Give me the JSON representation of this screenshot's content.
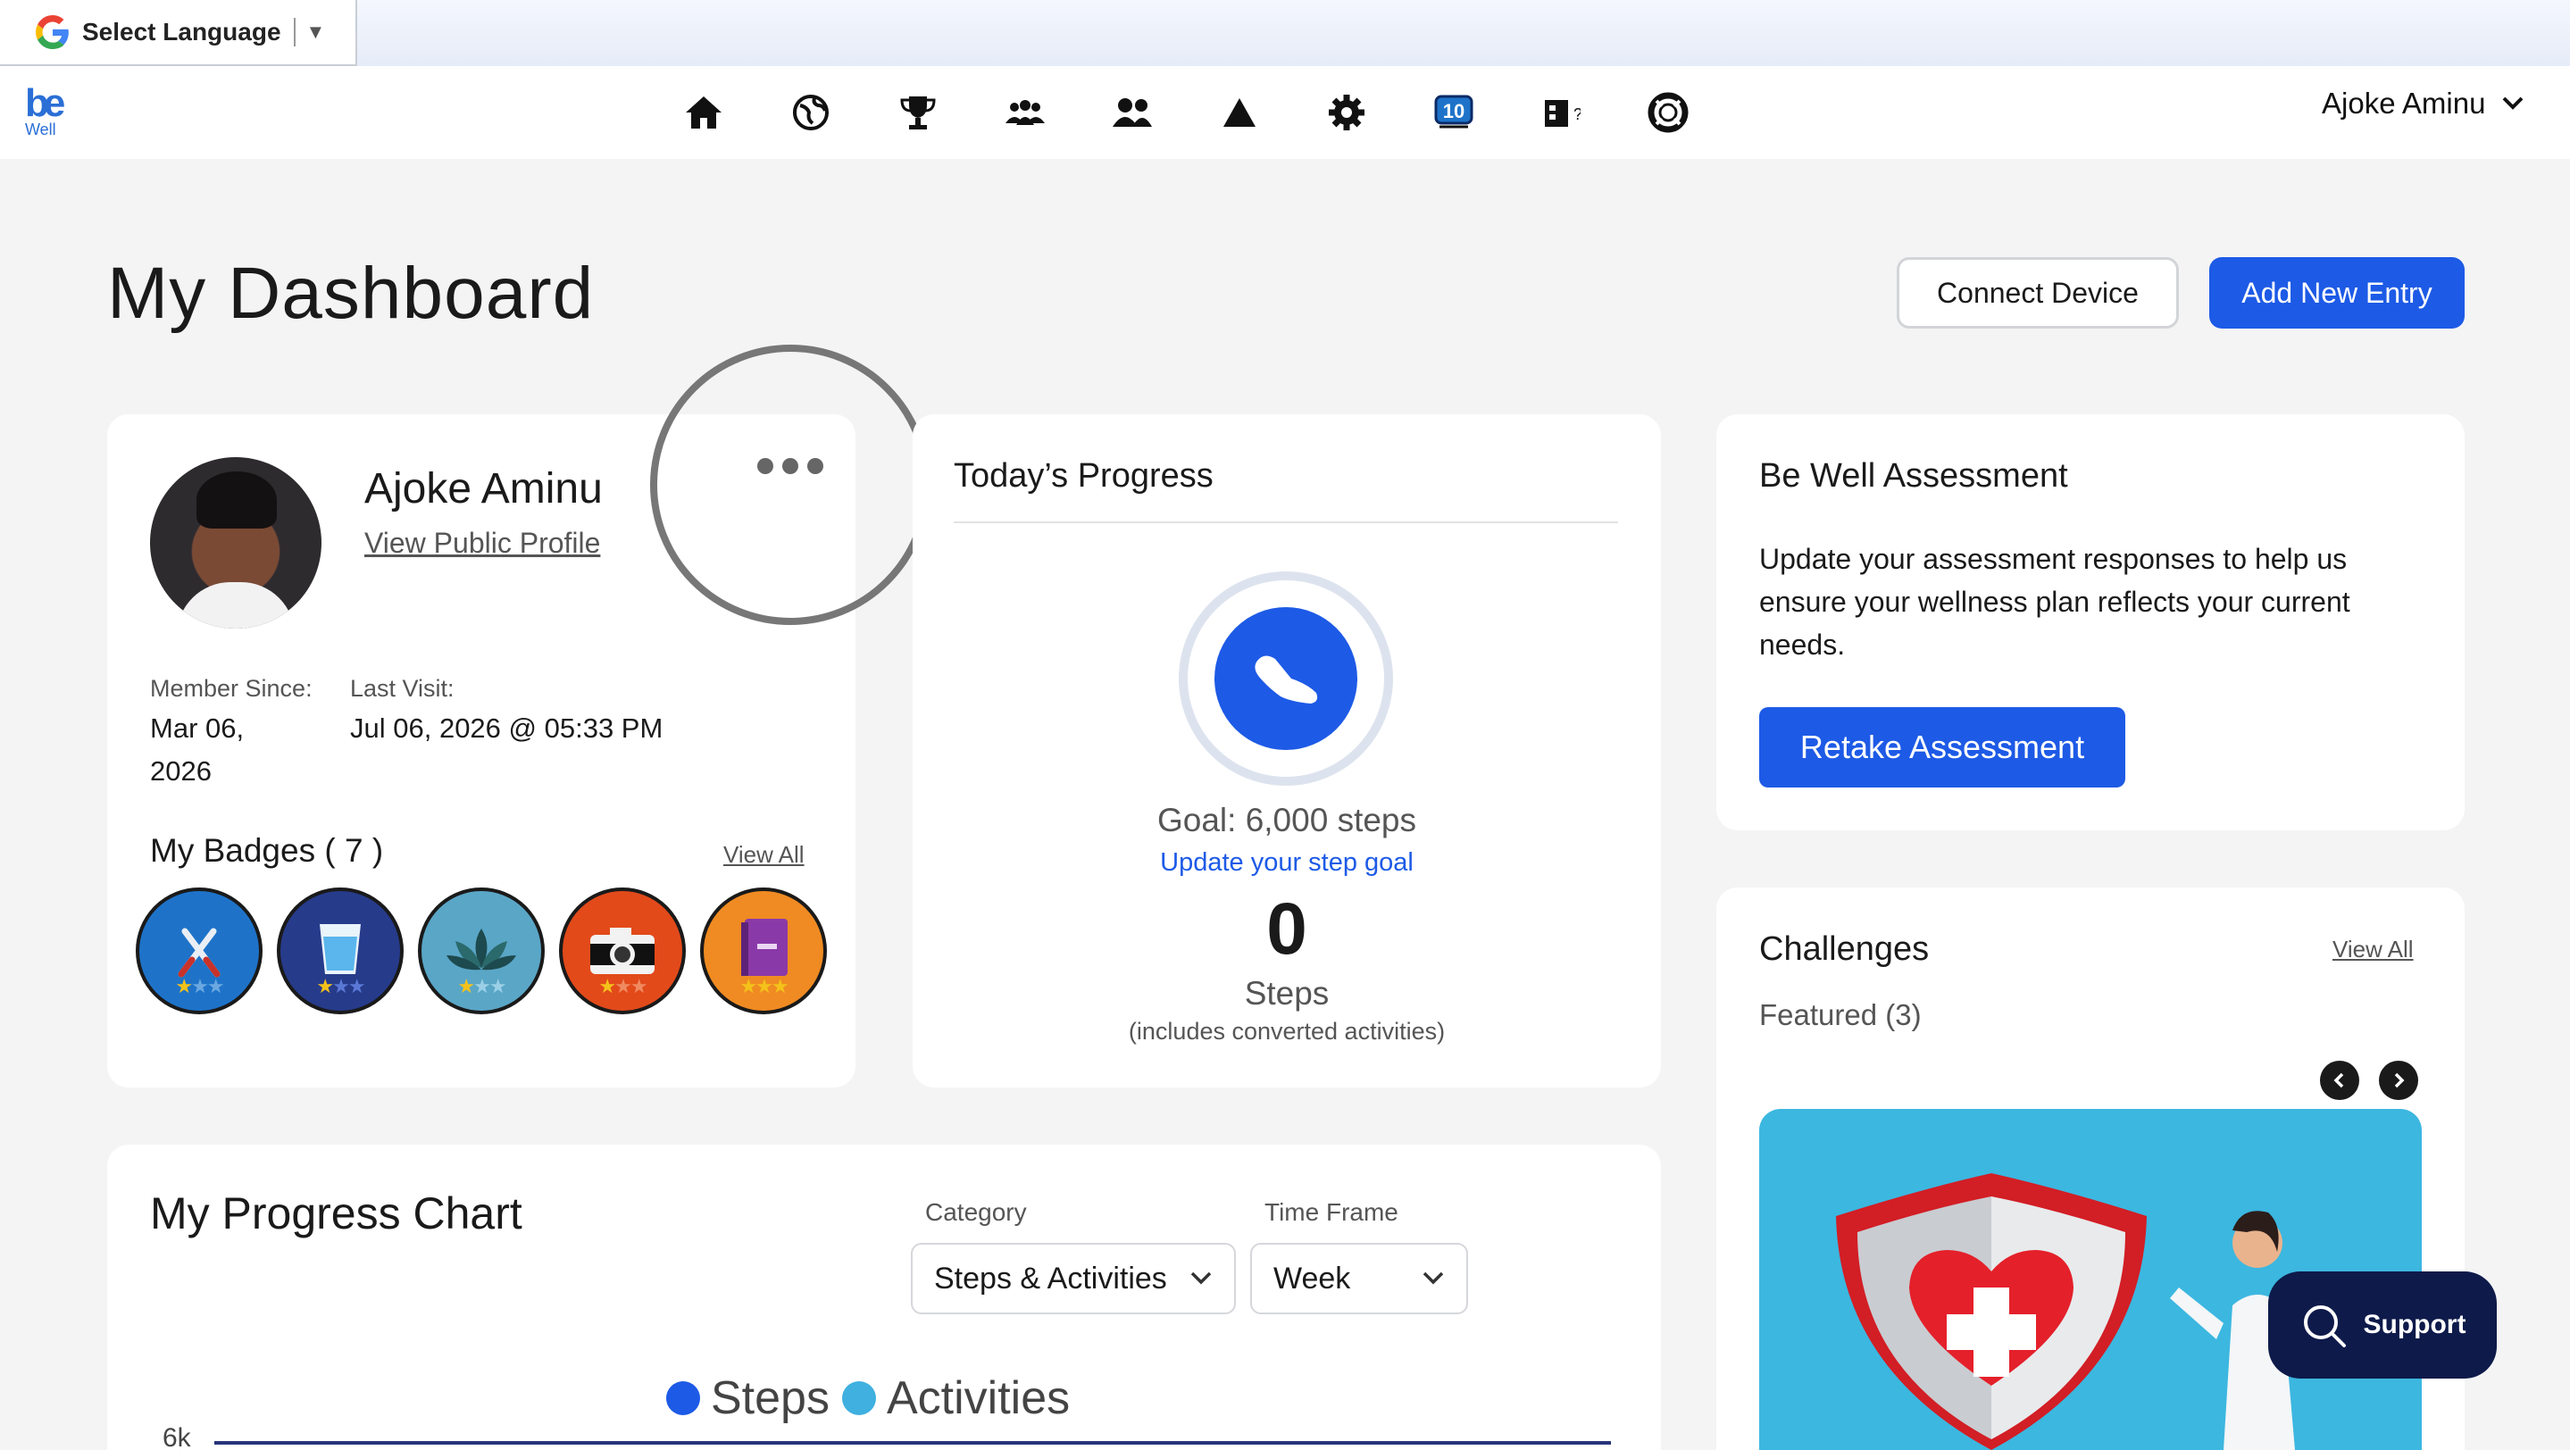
{
  "translate": {
    "label": "Select Language",
    "caret": "▼"
  },
  "brand": {
    "logo_text": "be",
    "logo_sub": "Well"
  },
  "nav": {
    "icons": [
      "home-icon",
      "globe-icon",
      "trophy-icon",
      "groups-icon",
      "people-icon",
      "triangle-icon",
      "gear-icon",
      "ten-badge-icon",
      "coffee-cup-icon",
      "lifebuoy-icon"
    ],
    "ten_label": "10",
    "user_name": "Ajoke Aminu"
  },
  "header": {
    "title": "My Dashboard",
    "connect_label": "Connect Device",
    "add_entry_label": "Add New Entry"
  },
  "profile": {
    "name": "Ajoke Aminu",
    "view_profile": "View Public Profile",
    "member_since_label": "Member Since:",
    "member_since_value_line1": "Mar 06,",
    "member_since_value_line2": "2026",
    "last_visit_label": "Last Visit:",
    "last_visit_value": "Jul 06, 2026 @ 05:33 PM",
    "badges_title": "My Badges ( 7 )",
    "badges_view_all": "View All",
    "badges": [
      {
        "icon": "fork-knife-icon",
        "color": "#1e73c9"
      },
      {
        "icon": "water-glass-icon",
        "color": "#263b8a"
      },
      {
        "icon": "lotus-icon",
        "color": "#5aa6c7"
      },
      {
        "icon": "camera-icon",
        "color": "#e24a1a"
      },
      {
        "icon": "journal-icon",
        "color": "#ef8b22"
      }
    ]
  },
  "progress": {
    "title": "Today’s Progress",
    "goal": "Goal: 6,000 steps",
    "update_goal": "Update your step goal",
    "steps": "0",
    "steps_label": "Steps",
    "steps_note": "(includes converted activities)"
  },
  "assessment": {
    "title": "Be Well Assessment",
    "text": "Update your assessment responses to help us ensure your wellness plan reflects your current needs.",
    "button": "Retake Assessment"
  },
  "challenges": {
    "title": "Challenges",
    "view_all": "View All",
    "featured": "Featured (3)"
  },
  "chart": {
    "title": "My Progress Chart",
    "category_label": "Category",
    "category_value": "Steps & Activities",
    "timeframe_label": "Time Frame",
    "timeframe_value": "Week",
    "legend_steps": "Steps",
    "legend_activities": "Activities",
    "y_tick": "6k",
    "colors": {
      "steps": "#1d5ae6",
      "activities": "#3fb0e0"
    }
  },
  "support": {
    "label": "Support"
  }
}
